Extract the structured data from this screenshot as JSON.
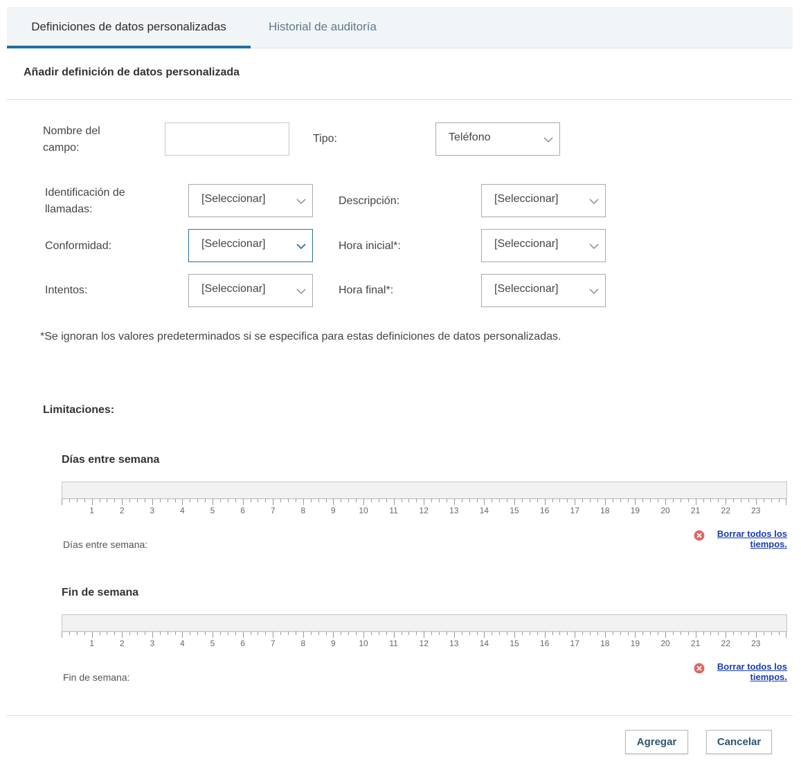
{
  "tabs": [
    {
      "label": "Definiciones de datos personalizadas",
      "active": true
    },
    {
      "label": "Historial de auditoría",
      "active": false
    }
  ],
  "section_title": "Añadir definición de datos personalizada",
  "fields": {
    "nombre_label": "Nombre del campo:",
    "nombre_value": "",
    "tipo_label": "Tipo:",
    "tipo_value": "Teléfono",
    "identificacion_label": "Identificación de llamadas:",
    "identificacion_value": "[Seleccionar]",
    "descripcion_label": "Descripción:",
    "descripcion_value": "[Seleccionar]",
    "conformidad_label": "Conformidad:",
    "conformidad_value": "[Seleccionar]",
    "hora_inicial_label": "Hora inicial*:",
    "hora_inicial_value": "[Seleccionar]",
    "intentos_label": "Intentos:",
    "intentos_value": "[Seleccionar]",
    "hora_final_label": "Hora final*:",
    "hora_final_value": "[Seleccionar]"
  },
  "note": "*Se ignoran los valores predeterminados si se especifica para estas definiciones de datos personalizadas.",
  "limitations": {
    "title": "Limitaciones:",
    "weekdays": {
      "title": "Días entre semana",
      "label": "Días entre semana:",
      "clear": "Borrar todos los tiempos."
    },
    "weekend": {
      "title": "Fin de semana",
      "label": "Fin de semana:",
      "clear": "Borrar todos los tiempos."
    },
    "hours": [
      "1",
      "2",
      "3",
      "4",
      "5",
      "6",
      "7",
      "8",
      "9",
      "10",
      "11",
      "12",
      "13",
      "14",
      "15",
      "16",
      "17",
      "18",
      "19",
      "20",
      "21",
      "22",
      "23"
    ]
  },
  "buttons": {
    "add": "Agregar",
    "cancel": "Cancelar"
  },
  "colors": {
    "active_tab_underline": "#1f6fa3",
    "link": "#1a3cb0",
    "clear_icon": "#e06666",
    "focused_select_border": "#2a6e9d"
  },
  "icons": {
    "dropdown": "chevron-down-icon",
    "clear": "close-circle-icon"
  }
}
